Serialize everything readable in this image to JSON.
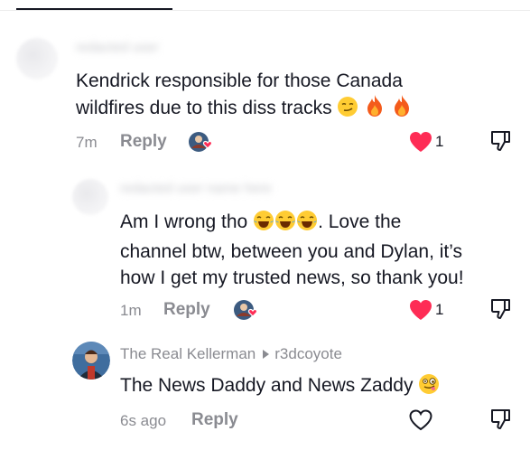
{
  "comments": [
    {
      "text_line1": "Kendrick responsible for those Canada",
      "text_line2": "wildfires due to this diss tracks",
      "time": "7m",
      "reply_label": "Reply",
      "like_count": "1"
    },
    {
      "text_line1": "Am I wrong tho",
      "text_line1_after": ". Love the",
      "text_line2": "channel btw, between you and Dylan, it’s",
      "text_line3": "how I get my trusted news, so thank you!",
      "time": "1m",
      "reply_label": "Reply",
      "like_count": "1"
    },
    {
      "author": "The Real Kellerman",
      "reply_to": "r3dcoyote",
      "text": "The News Daddy and News Zaddy",
      "time": "6s ago",
      "reply_label": "Reply"
    }
  ],
  "icons": {
    "liked_heart": "heart-filled-red",
    "unliked_heart": "heart-outline",
    "dislike": "thumbs-down",
    "creator_liked": "creator-avatar-with-heart"
  },
  "colors": {
    "like_red": "#fe2c55",
    "muted_text": "#8a8b91",
    "primary_text": "#161823"
  }
}
